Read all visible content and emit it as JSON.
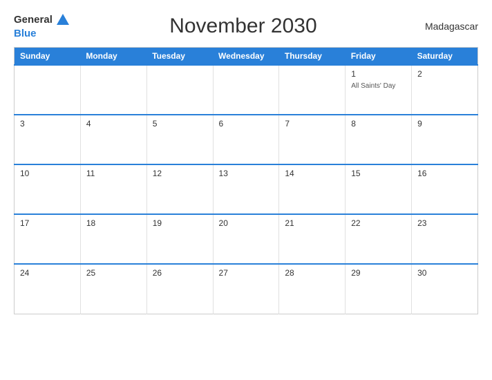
{
  "header": {
    "logo_general": "General",
    "logo_blue": "Blue",
    "title": "November 2030",
    "country": "Madagascar"
  },
  "days_of_week": [
    "Sunday",
    "Monday",
    "Tuesday",
    "Wednesday",
    "Thursday",
    "Friday",
    "Saturday"
  ],
  "weeks": [
    [
      {
        "day": "",
        "empty": true
      },
      {
        "day": "",
        "empty": true
      },
      {
        "day": "",
        "empty": true
      },
      {
        "day": "",
        "empty": true
      },
      {
        "day": "",
        "empty": true
      },
      {
        "day": "1",
        "holiday": "All Saints' Day"
      },
      {
        "day": "2"
      }
    ],
    [
      {
        "day": "3"
      },
      {
        "day": "4"
      },
      {
        "day": "5"
      },
      {
        "day": "6"
      },
      {
        "day": "7"
      },
      {
        "day": "8"
      },
      {
        "day": "9"
      }
    ],
    [
      {
        "day": "10"
      },
      {
        "day": "11"
      },
      {
        "day": "12"
      },
      {
        "day": "13"
      },
      {
        "day": "14"
      },
      {
        "day": "15"
      },
      {
        "day": "16"
      }
    ],
    [
      {
        "day": "17"
      },
      {
        "day": "18"
      },
      {
        "day": "19"
      },
      {
        "day": "20"
      },
      {
        "day": "21"
      },
      {
        "day": "22"
      },
      {
        "day": "23"
      }
    ],
    [
      {
        "day": "24"
      },
      {
        "day": "25"
      },
      {
        "day": "26"
      },
      {
        "day": "27"
      },
      {
        "day": "28"
      },
      {
        "day": "29"
      },
      {
        "day": "30"
      }
    ]
  ]
}
